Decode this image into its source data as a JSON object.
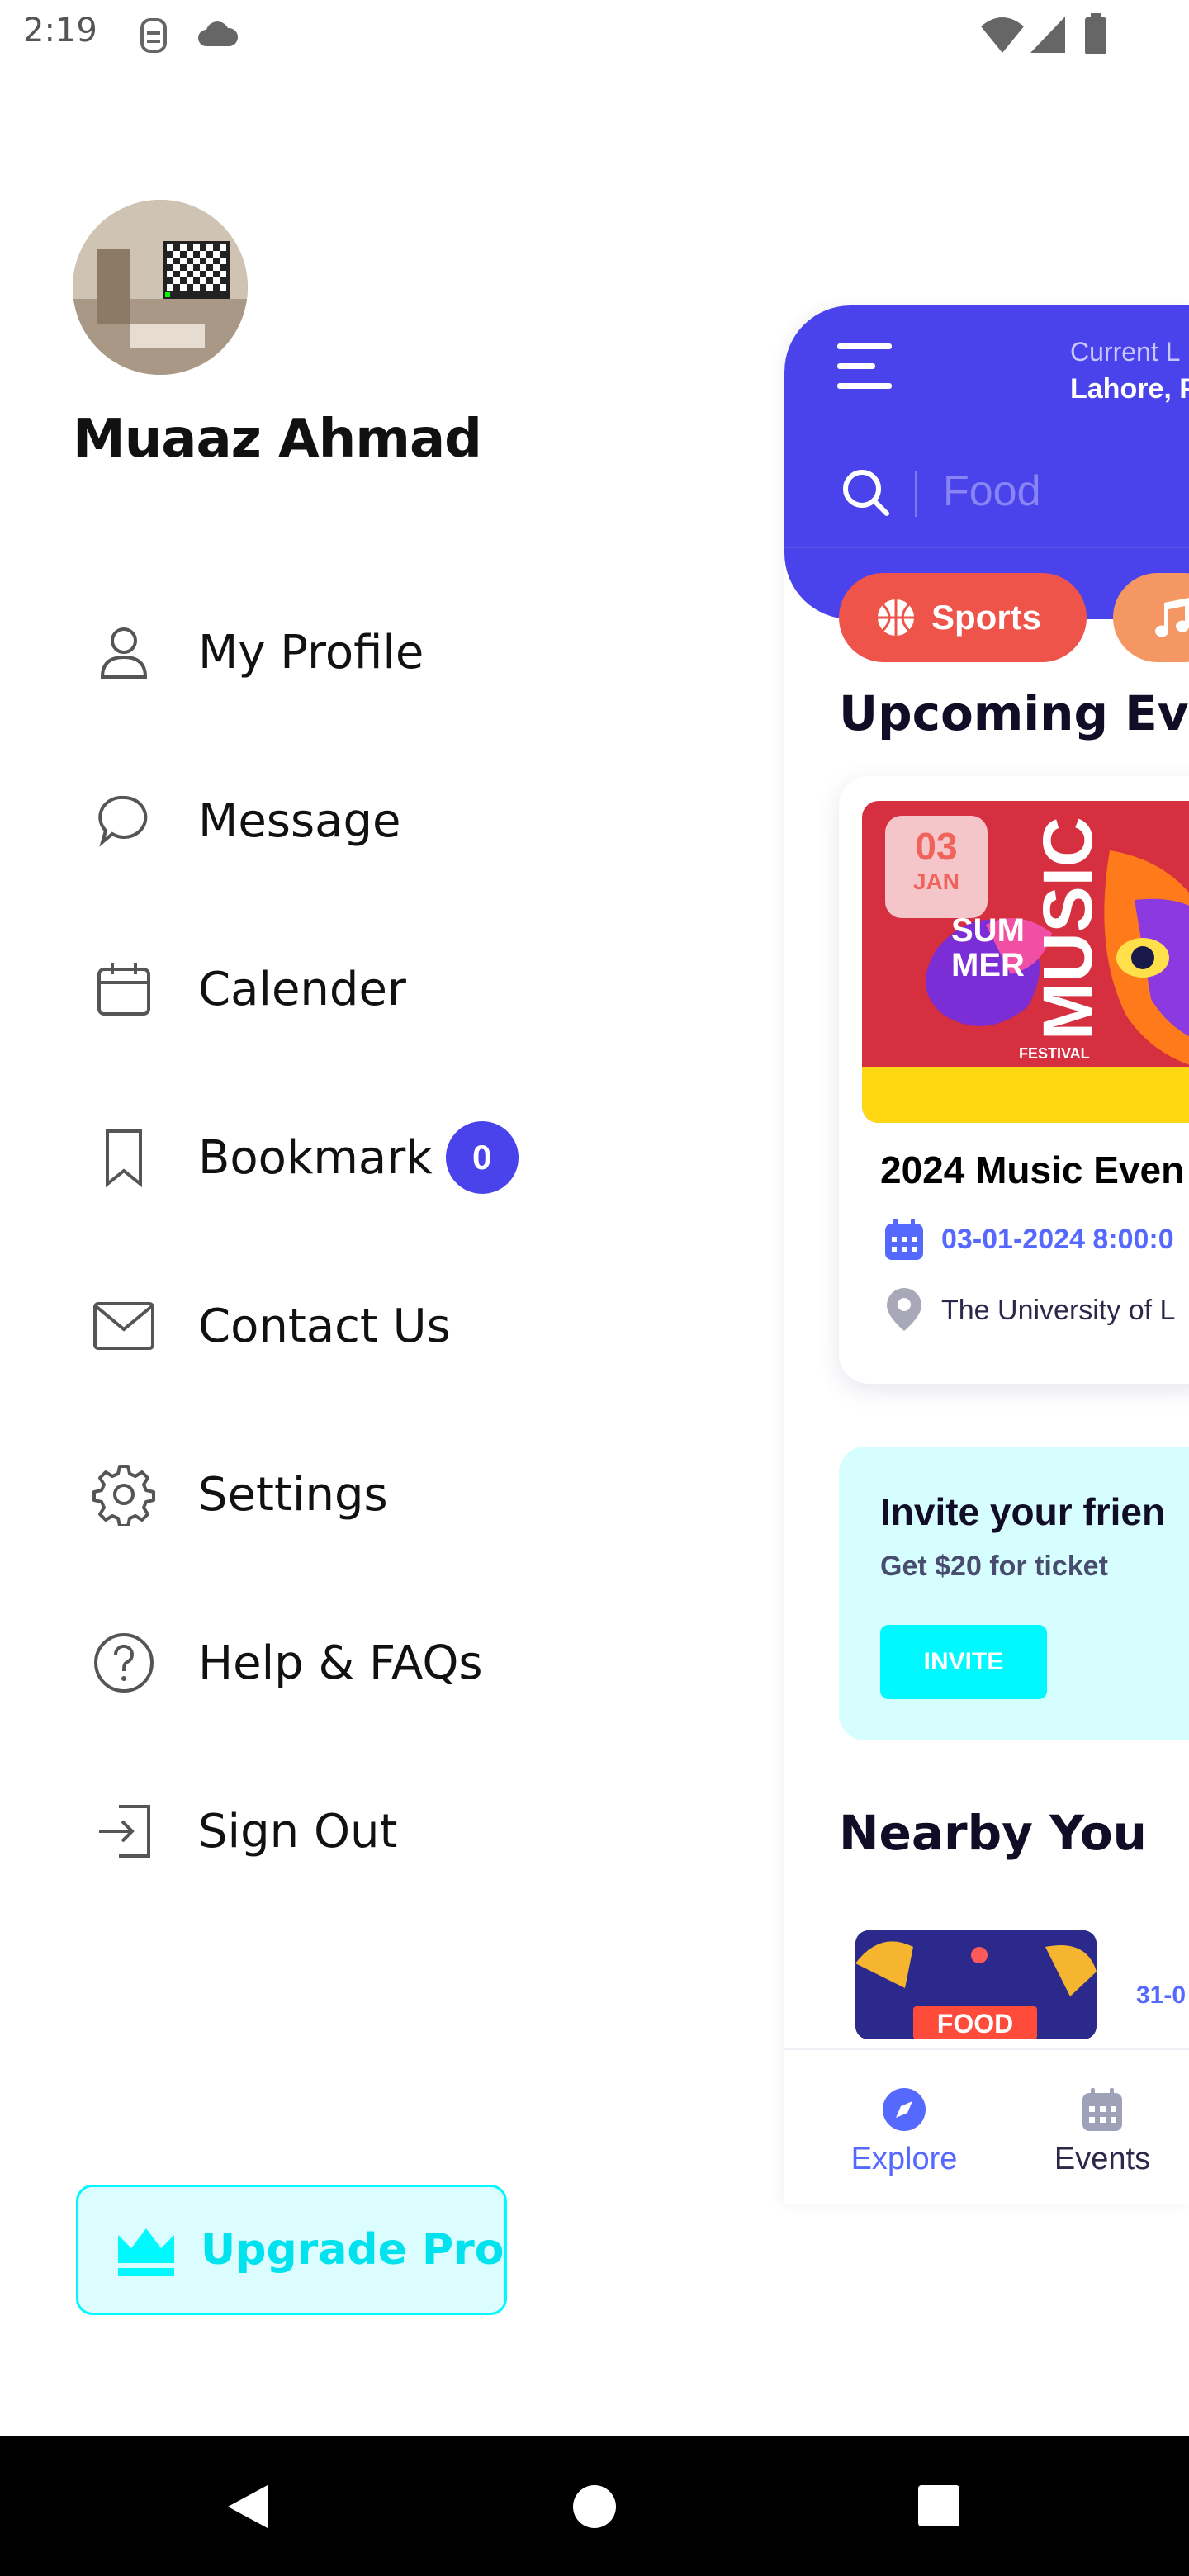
{
  "status_bar": {
    "time": "2:19"
  },
  "drawer": {
    "user_name": "Muaaz Ahmad",
    "menu": [
      {
        "label": "My Profile",
        "icon": "user-icon"
      },
      {
        "label": "Message",
        "icon": "message-icon"
      },
      {
        "label": "Calender",
        "icon": "calendar-icon"
      },
      {
        "label": "Bookmark",
        "icon": "bookmark-icon",
        "badge": "0"
      },
      {
        "label": "Contact Us",
        "icon": "mail-icon"
      },
      {
        "label": "Settings",
        "icon": "gear-icon"
      },
      {
        "label": "Help & FAQs",
        "icon": "help-icon"
      },
      {
        "label": "Sign Out",
        "icon": "sign-out-icon"
      }
    ],
    "upgrade_label": "Upgrade Pro"
  },
  "preview": {
    "current_location_label": "Current L",
    "current_location_value": "Lahore, P",
    "search_placeholder": "Food",
    "categories": [
      {
        "label": "Sports",
        "color": "#EE544A"
      },
      {
        "label": "",
        "color": "#F59762"
      }
    ],
    "upcoming_title": "Upcoming Even",
    "event": {
      "day": "03",
      "month": "JAN",
      "poster_text_1": "SUM",
      "poster_text_2": "MER",
      "poster_text_3": "MUSIC",
      "poster_text_4": "FESTIVAL",
      "title": "2024 Music Even",
      "datetime": "03-01-2024 8:00:0",
      "place": "The University of L"
    },
    "invite": {
      "title": "Invite your frien",
      "subtitle": "Get $20 for ticket",
      "button": "INVITE"
    },
    "nearby_title": "Nearby You",
    "nearby_item": {
      "thumb_text": "FOOD",
      "date": "31-0"
    },
    "nav": {
      "explore": "Explore",
      "events": "Events"
    }
  },
  "colors": {
    "primary": "#4A43EC",
    "accent_cyan": "#00F8FF",
    "sports_chip": "#EE544A"
  }
}
